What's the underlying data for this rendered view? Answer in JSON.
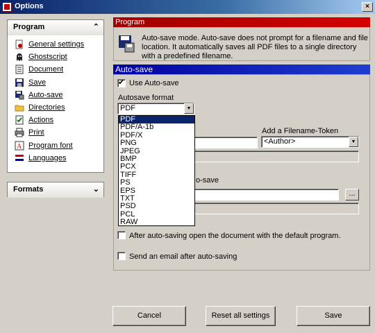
{
  "window": {
    "title": "Options",
    "close_glyph": "×"
  },
  "sidebar": {
    "program": {
      "header": "Program",
      "collapse_glyph": "⌃",
      "items": [
        {
          "label": "General settings",
          "icon": "document-gear-icon"
        },
        {
          "label": "Ghostscript",
          "icon": "ghost-icon"
        },
        {
          "label": "Document",
          "icon": "document-icon"
        },
        {
          "label": "Save",
          "icon": "save-icon"
        },
        {
          "label": "Auto-save",
          "icon": "autosave-icon"
        },
        {
          "label": "Directories",
          "icon": "folder-icon"
        },
        {
          "label": "Actions",
          "icon": "actions-icon"
        },
        {
          "label": "Print",
          "icon": "printer-icon"
        },
        {
          "label": "Program font",
          "icon": "font-icon"
        },
        {
          "label": "Languages",
          "icon": "languages-icon"
        }
      ]
    },
    "formats": {
      "header": "Formats",
      "expand_glyph": "⌄"
    }
  },
  "program_section": {
    "header": "Program",
    "description": "Auto-save mode. Auto-save does not prompt for a filename and file location. It automatically saves all PDF files to a single directory with a predefined filename."
  },
  "autosave": {
    "header": "Auto-save",
    "use_autosave_label": "Use Auto-save",
    "use_autosave_checked": true,
    "format_label": "Autosave format",
    "format_selected": "PDF",
    "format_options": [
      "PDF",
      "PDF/A-1b",
      "PDF/X",
      "PNG",
      "JPEG",
      "BMP",
      "PCX",
      "TIFF",
      "PS",
      "EPS",
      "TXT",
      "PSD",
      "PCL",
      "RAW"
    ],
    "token_label": "Add a Filename-Token",
    "token_selected": "<Author>",
    "directory_label_partial": "o-save",
    "browse_label": "...",
    "open_after_label": "After auto-saving open the document with the default program.",
    "open_after_checked": false,
    "send_email_label": "Send an email after auto-saving",
    "send_email_checked": false
  },
  "buttons": {
    "cancel": "Cancel",
    "reset": "Reset all settings",
    "save": "Save"
  },
  "colors": {
    "program_header": "#c00000",
    "autosave_header": "#0000c0",
    "selection": "#0a246a"
  }
}
